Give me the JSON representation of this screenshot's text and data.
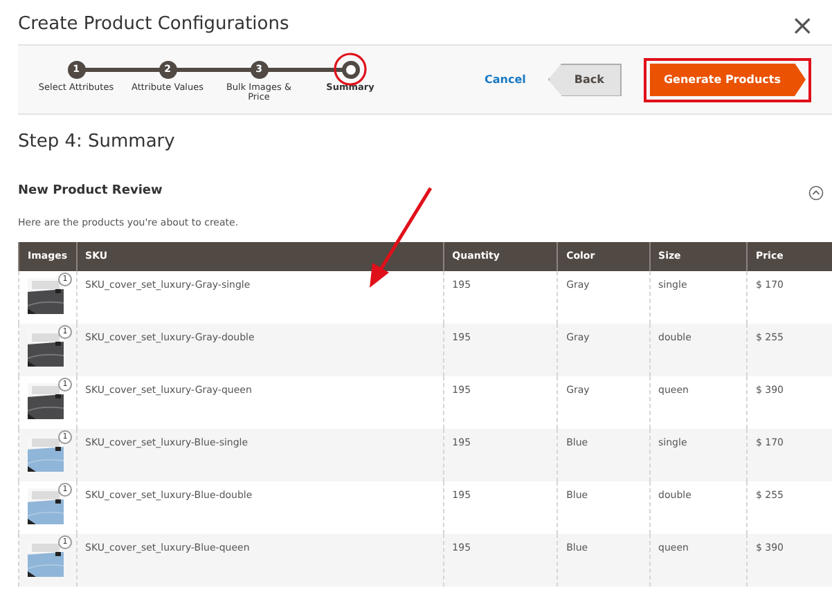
{
  "window": {
    "title": "Create Product Configurations",
    "close": "×"
  },
  "steps": [
    {
      "number": "1",
      "label": "Select Attributes",
      "selected": false
    },
    {
      "number": "2",
      "label": "Attribute Values",
      "selected": false
    },
    {
      "number": "3",
      "label": "Bulk Images & Price",
      "selected": false
    },
    {
      "label": "Summary",
      "selected": true
    }
  ],
  "actions": {
    "cancel": "Cancel",
    "back": "Back",
    "generate": "Generate Products"
  },
  "heading": "Step 4: Summary",
  "section": {
    "title": "New Product Review",
    "expanded": true,
    "intro": "Here are the products you're about to create."
  },
  "table": {
    "columns": [
      "Images",
      "SKU",
      "Quantity",
      "Color",
      "Size",
      "Price"
    ],
    "rows": [
      {
        "image_count": "1",
        "color": "#4a4a4c",
        "sku": "SKU_cover_set_luxury-Gray-single",
        "quantity": "195",
        "color_name": "Gray",
        "size": "single",
        "price": "$ 170"
      },
      {
        "image_count": "1",
        "color": "#4a4a4c",
        "sku": "SKU_cover_set_luxury-Gray-double",
        "quantity": "195",
        "color_name": "Gray",
        "size": "double",
        "price": "$ 255"
      },
      {
        "image_count": "1",
        "color": "#4a4a4c",
        "sku": "SKU_cover_set_luxury-Gray-queen",
        "quantity": "195",
        "color_name": "Gray",
        "size": "queen",
        "price": "$ 390"
      },
      {
        "image_count": "1",
        "color": "#8fb5d8",
        "sku": "SKU_cover_set_luxury-Blue-single",
        "quantity": "195",
        "color_name": "Blue",
        "size": "single",
        "price": "$ 170"
      },
      {
        "image_count": "1",
        "color": "#8fb5d8",
        "sku": "SKU_cover_set_luxury-Blue-double",
        "quantity": "195",
        "color_name": "Blue",
        "size": "double",
        "price": "$ 255"
      },
      {
        "image_count": "1",
        "color": "#8fb5d8",
        "sku": "SKU_cover_set_luxury-Blue-queen",
        "quantity": "195",
        "color_name": "Blue",
        "size": "queen",
        "price": "$ 390"
      }
    ]
  }
}
